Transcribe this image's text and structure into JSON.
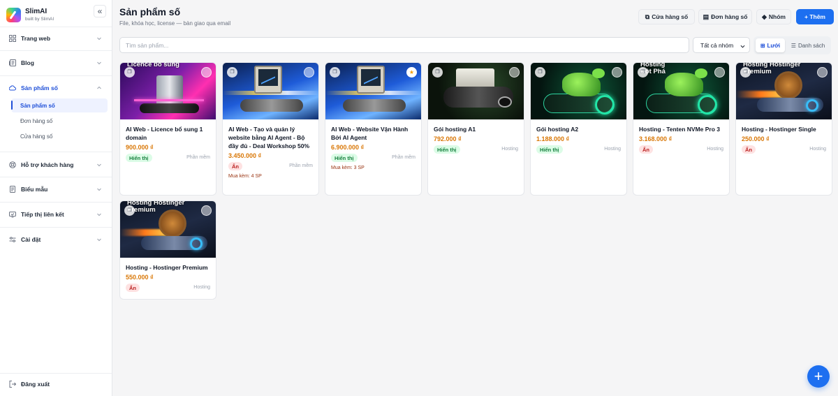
{
  "app": {
    "name": "SlimAI",
    "tagline": "built by SlimAI",
    "collapse_icon": "chevrons-left-icon"
  },
  "sidebar": {
    "items": [
      {
        "label": "Trang web",
        "icon": "grid-icon"
      },
      {
        "label": "Blog",
        "icon": "newspaper-icon"
      },
      {
        "label": "Sản phẩm số",
        "icon": "cloud-icon",
        "expanded": true,
        "children": [
          {
            "label": "Sản phẩm số",
            "active": true
          },
          {
            "label": "Đơn hàng số"
          },
          {
            "label": "Cửa hàng số"
          }
        ]
      },
      {
        "label": "Hỗ trợ khách hàng",
        "icon": "lifebuoy-icon"
      },
      {
        "label": "Biểu mẫu",
        "icon": "form-icon"
      },
      {
        "label": "Tiếp thị liên kết",
        "icon": "affiliate-icon"
      },
      {
        "label": "Cài đặt",
        "icon": "sliders-icon"
      }
    ],
    "logout_label": "Đăng xuất"
  },
  "header": {
    "title": "Sản phẩm số",
    "subtitle": "File, khóa học, license — bàn giao qua email",
    "buttons": {
      "store": "Cửa hàng số",
      "orders": "Đơn hàng số",
      "groups": "Nhóm",
      "add": "+ Thêm"
    }
  },
  "filters": {
    "search_placeholder": "Tìm sản phẩm...",
    "group_select": {
      "selected": "Tất cả nhóm"
    },
    "view": {
      "grid": "Lưới",
      "list": "Danh sách",
      "active": "grid"
    }
  },
  "products": [
    {
      "name": "AI Web - Licence bổ sung 1 domain",
      "price": "900.000 ₫",
      "status": "Hiển thị",
      "visible": true,
      "category": "Phần mềm",
      "thumb_caption": "Licence bổ sung",
      "thumb": "licence",
      "starred": false
    },
    {
      "name": "AI Web - Tạo và quản lý website bằng AI Agent - Bộ đầy đủ - Deal Workshop 50%",
      "price": "3.450.000 ₫",
      "status": "Ẩn",
      "visible": false,
      "category": "Phần mềm",
      "bundle": "Mua kèm: 4 SP",
      "thumb_caption": "",
      "thumb": "aiweb",
      "starred": false
    },
    {
      "name": "AI Web - Website Vận Hành Bởi AI Agent",
      "price": "6.900.000 ₫",
      "status": "Hiển thị",
      "visible": true,
      "category": "Phần mềm",
      "bundle": "Mua kèm: 3 SP",
      "thumb_caption": "",
      "thumb": "aiweb",
      "starred": true
    },
    {
      "name": "Gói hosting A1",
      "price": "792.000 ₫",
      "status": "Hiển thị",
      "visible": true,
      "category": "Hosting",
      "thumb_caption": "",
      "thumb": "printer",
      "starred": false
    },
    {
      "name": "Gói hosting A2",
      "price": "1.188.000 ₫",
      "status": "Hiển thị",
      "visible": true,
      "category": "Hosting",
      "thumb_caption": "",
      "thumb": "mantis",
      "starred": false
    },
    {
      "name": "Hosting - Tenten NVMe Pro 3",
      "price": "3.168.000 ₫",
      "status": "Ẩn",
      "visible": false,
      "category": "Hosting",
      "thumb_caption": "Hosting\nĐột Phá",
      "thumb": "mantis",
      "starred": false
    },
    {
      "name": "Hosting - Hostinger Single",
      "price": "250.000 ₫",
      "status": "Ẩn",
      "visible": false,
      "category": "Hosting",
      "thumb_caption": "Hosting Hostinger\nPremium",
      "thumb": "snail",
      "starred": false
    },
    {
      "name": "Hosting - Hostinger Premium",
      "price": "550.000 ₫",
      "status": "Ẩn",
      "visible": false,
      "category": "Hosting",
      "thumb_caption": "Hosting Hostinger\nPremium",
      "thumb": "snail",
      "starred": false
    }
  ],
  "fab": {
    "icon": "plus-icon"
  },
  "colors": {
    "primary": "#1d6ff0",
    "price": "#d97706",
    "visible_bg": "#dcfce7",
    "hidden_bg": "#fee2e2"
  }
}
